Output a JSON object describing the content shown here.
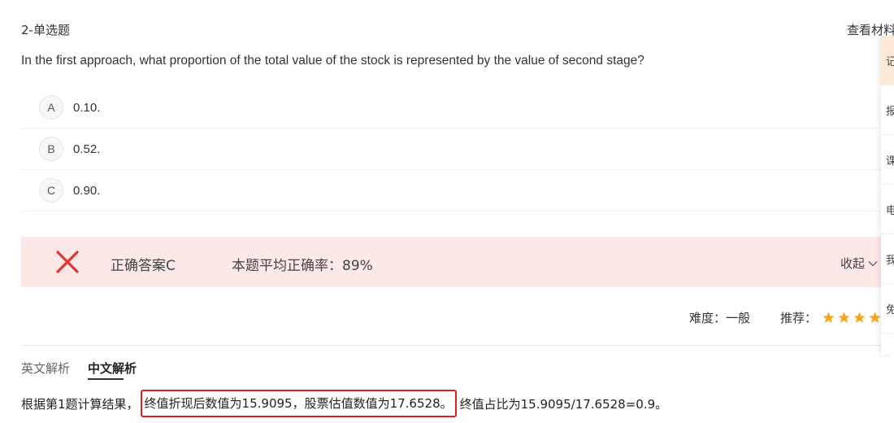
{
  "question": {
    "type_label": "2-单选题",
    "view_material": "查看材料",
    "text": "In the first approach, what proportion of the total value of the stock is represented by the value of second stage?",
    "options": [
      {
        "letter": "A",
        "text": "0.10."
      },
      {
        "letter": "B",
        "text": "0.52."
      },
      {
        "letter": "C",
        "text": "0.90."
      }
    ]
  },
  "result": {
    "status_icon": "wrong-x-icon",
    "correct_answer": "正确答案C",
    "avg_accuracy": "本题平均正确率：89%",
    "collapse_label": "收起"
  },
  "meta": {
    "difficulty": "难度：一般",
    "recommend_label": "推荐：",
    "stars": 4
  },
  "analysis": {
    "tab_en": "英文解析",
    "tab_zh": "中文解析",
    "prefix": "根据第1题计算结果，",
    "highlight": "终值折现后数值为15.9095，股票估值数值为17.6528。",
    "suffix": "终值占比为15.9095/17.6528=0.9。"
  },
  "side_panel": {
    "items": [
      "记",
      "报",
      "课",
      "电",
      "我",
      "免"
    ]
  },
  "colors": {
    "result_bg": "#fde8e8",
    "wrong_red": "#e0342d",
    "star_orange": "#f5a623",
    "highlight_border": "#e02020"
  }
}
